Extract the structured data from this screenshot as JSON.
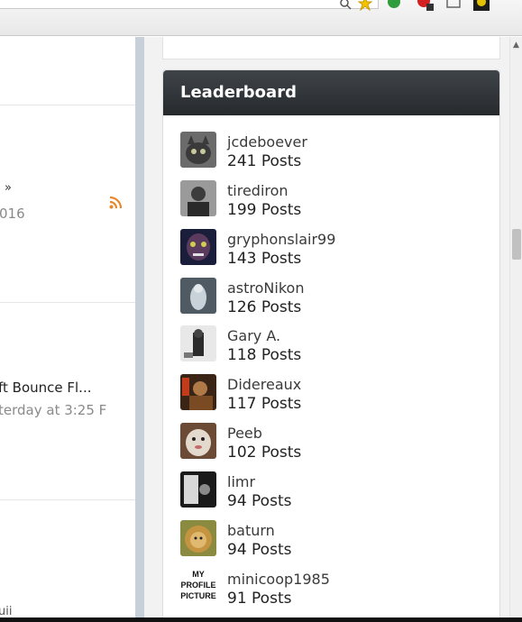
{
  "left_panel": {
    "link_arrow": "»",
    "year_fragment": "016",
    "thread_title": "ft Bounce Fl...",
    "thread_time": "terday at 3:25 F",
    "bottom_fragment": "uii"
  },
  "leaderboard": {
    "title": "Leaderboard",
    "entries": [
      {
        "username": "jcdeboever",
        "posts": "241 Posts",
        "avatar": "cat-avatar"
      },
      {
        "username": "tirediron",
        "posts": "199 Posts",
        "avatar": "man-avatar"
      },
      {
        "username": "gryphonslair99",
        "posts": "143 Posts",
        "avatar": "mask-avatar"
      },
      {
        "username": "astroNikon",
        "posts": "126 Posts",
        "avatar": "astronaut-avatar"
      },
      {
        "username": "Gary A.",
        "posts": "118 Posts",
        "avatar": "photographer-avatar"
      },
      {
        "username": "Didereaux",
        "posts": "117 Posts",
        "avatar": "portrait-avatar"
      },
      {
        "username": "Peeb",
        "posts": "102 Posts",
        "avatar": "dog-avatar"
      },
      {
        "username": "limr",
        "posts": "94 Posts",
        "avatar": "bw-photo-avatar"
      },
      {
        "username": "baturn",
        "posts": "94 Posts",
        "avatar": "lion-avatar"
      },
      {
        "username": "minicoop1985",
        "posts": "91 Posts",
        "avatar": "text-avatar",
        "avatar_text": "MY PROFILE PICTURE"
      }
    ]
  },
  "colors": {
    "header_dark": "#2b2f32",
    "rss_orange": "#e8872b",
    "sidebar_bg": "#f2f2f2"
  }
}
